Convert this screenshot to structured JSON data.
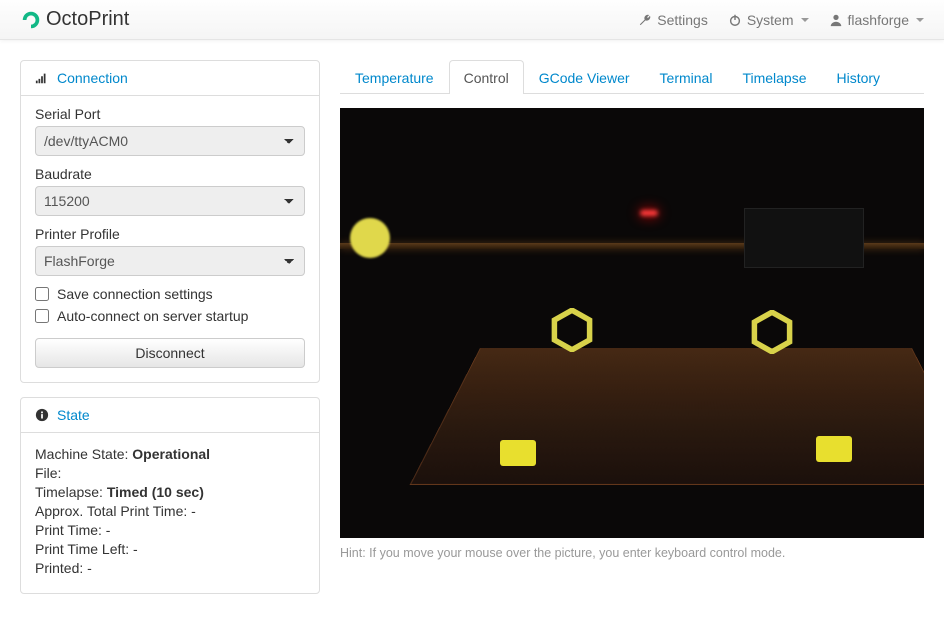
{
  "brand": "OctoPrint",
  "nav": {
    "settings": "Settings",
    "system": "System",
    "user": "flashforge"
  },
  "sidebar": {
    "connection": {
      "title": "Connection",
      "serial_label": "Serial Port",
      "serial_value": "/dev/ttyACM0",
      "baud_label": "Baudrate",
      "baud_value": "115200",
      "profile_label": "Printer Profile",
      "profile_value": "FlashForge",
      "save_label": "Save connection settings",
      "auto_label": "Auto-connect on server startup",
      "disconnect": "Disconnect"
    },
    "state": {
      "title": "State",
      "machine_state_label": "Machine State: ",
      "machine_state_value": "Operational",
      "file_label": "File:",
      "file_value": "",
      "timelapse_label": "Timelapse: ",
      "timelapse_value": "Timed (10 sec)",
      "approx_label": "Approx. Total Print Time: ",
      "approx_value": "-",
      "printtime_label": "Print Time: ",
      "printtime_value": "-",
      "printleft_label": "Print Time Left: ",
      "printleft_value": "-",
      "printed_label": "Printed: ",
      "printed_value": "-"
    }
  },
  "tabs": {
    "temperature": "Temperature",
    "control": "Control",
    "gcode": "GCode Viewer",
    "terminal": "Terminal",
    "timelapse": "Timelapse",
    "history": "History"
  },
  "control": {
    "hint": "Hint: If you move your mouse over the picture, you enter keyboard control mode."
  }
}
